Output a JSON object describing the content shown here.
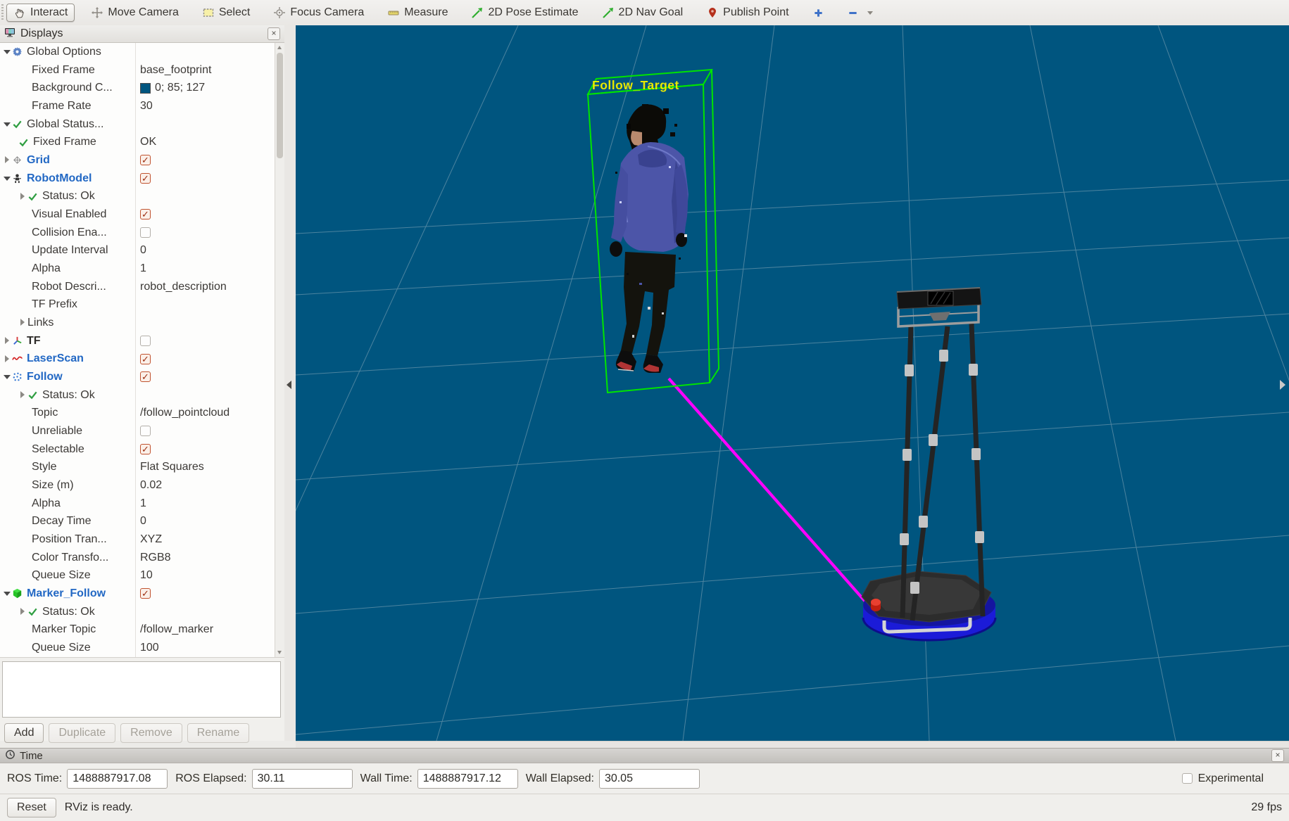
{
  "toolbar": {
    "tools": [
      {
        "label": "Interact",
        "icon": "hand-icon",
        "active": true
      },
      {
        "label": "Move Camera",
        "icon": "move-camera-icon"
      },
      {
        "label": "Select",
        "icon": "select-box-icon"
      },
      {
        "label": "Focus Camera",
        "icon": "focus-camera-icon"
      },
      {
        "label": "Measure",
        "icon": "measure-icon"
      },
      {
        "label": "2D Pose Estimate",
        "icon": "pose-arrow-icon"
      },
      {
        "label": "2D Nav Goal",
        "icon": "nav-arrow-icon"
      },
      {
        "label": "Publish Point",
        "icon": "publish-point-icon"
      },
      {
        "label": "",
        "icon": "add-tool-icon"
      },
      {
        "label": "",
        "icon": "remove-tool-icon",
        "caret": true
      }
    ]
  },
  "displays_panel": {
    "title": "Displays",
    "close_label": "×",
    "rows": [
      {
        "indent": 0,
        "expander": "open",
        "icon": "gear-icon",
        "label": "Global Options"
      },
      {
        "indent": 1,
        "label": "Fixed Frame",
        "value": "base_footprint"
      },
      {
        "indent": 1,
        "label": "Background C...",
        "swatch": "#00557F",
        "value": "0; 85; 127"
      },
      {
        "indent": 1,
        "label": "Frame Rate",
        "value": "30"
      },
      {
        "indent": 0,
        "expander": "open",
        "icon": "check-icon",
        "label": "Global Status..."
      },
      {
        "indent": 1,
        "icon": "check-icon",
        "label": "Fixed Frame",
        "value": "OK"
      },
      {
        "indent": 0,
        "expander": "closed",
        "icon": "grid-icon",
        "label": "Grid",
        "style": "display-on",
        "checkbox": true
      },
      {
        "indent": 0,
        "expander": "open",
        "icon": "robot-icon",
        "label": "RobotModel",
        "style": "display-on",
        "checkbox": true
      },
      {
        "indent": 1,
        "expander": "closed",
        "icon": "check-icon",
        "label": "Status: Ok"
      },
      {
        "indent": 1,
        "label": "Visual Enabled",
        "checkbox": true
      },
      {
        "indent": 1,
        "label": "Collision Ena...",
        "checkbox": false
      },
      {
        "indent": 1,
        "label": "Update Interval",
        "value": "0"
      },
      {
        "indent": 1,
        "label": "Alpha",
        "value": "1"
      },
      {
        "indent": 1,
        "label": "Robot Descri...",
        "value": "robot_description"
      },
      {
        "indent": 1,
        "label": "TF Prefix",
        "value": ""
      },
      {
        "indent": 1,
        "expander": "closed",
        "label": "Links"
      },
      {
        "indent": 0,
        "expander": "closed",
        "icon": "tf-icon",
        "label": "TF",
        "style": "display-off",
        "checkbox": false
      },
      {
        "indent": 0,
        "expander": "closed",
        "icon": "laser-icon",
        "label": "LaserScan",
        "style": "display-on",
        "checkbox": true
      },
      {
        "indent": 0,
        "expander": "open",
        "icon": "pointcloud-icon",
        "label": "Follow",
        "style": "display-on",
        "checkbox": true
      },
      {
        "indent": 1,
        "expander": "closed",
        "icon": "check-icon",
        "label": "Status: Ok"
      },
      {
        "indent": 1,
        "label": "Topic",
        "value": "/follow_pointcloud"
      },
      {
        "indent": 1,
        "label": "Unreliable",
        "checkbox": false
      },
      {
        "indent": 1,
        "label": "Selectable",
        "checkbox": true
      },
      {
        "indent": 1,
        "label": "Style",
        "value": "Flat Squares"
      },
      {
        "indent": 1,
        "label": "Size (m)",
        "value": "0.02"
      },
      {
        "indent": 1,
        "label": "Alpha",
        "value": "1"
      },
      {
        "indent": 1,
        "label": "Decay Time",
        "value": "0"
      },
      {
        "indent": 1,
        "label": "Position Tran...",
        "value": "XYZ"
      },
      {
        "indent": 1,
        "label": "Color Transfo...",
        "value": "RGB8"
      },
      {
        "indent": 1,
        "label": "Queue Size",
        "value": "10"
      },
      {
        "indent": 0,
        "expander": "open",
        "icon": "cube-icon",
        "label": "Marker_Follow",
        "style": "display-on",
        "checkbox": true
      },
      {
        "indent": 1,
        "expander": "closed",
        "icon": "check-icon",
        "label": "Status: Ok"
      },
      {
        "indent": 1,
        "label": "Marker Topic",
        "value": "/follow_marker"
      },
      {
        "indent": 1,
        "label": "Queue Size",
        "value": "100"
      }
    ],
    "buttons": [
      {
        "label": "Add",
        "enabled": true
      },
      {
        "label": "Duplicate",
        "enabled": false
      },
      {
        "label": "Remove",
        "enabled": false
      },
      {
        "label": "Rename",
        "enabled": false
      }
    ]
  },
  "viewport": {
    "background_color_rgb": "0; 85; 127",
    "background_hex": "#00557F",
    "follow_target_label": "Follow_Target",
    "label_color": "#e8e800",
    "bounding_box_color": "#00e400",
    "follow_line_color": "#ff00ff",
    "grid_line_color": "#a8bcc6"
  },
  "time_panel": {
    "title": "Time",
    "close_label": "×",
    "fields": [
      {
        "label": "ROS Time:",
        "value": "1488887917.08"
      },
      {
        "label": "ROS Elapsed:",
        "value": "30.11"
      },
      {
        "label": "Wall Time:",
        "value": "1488887917.12"
      },
      {
        "label": "Wall Elapsed:",
        "value": "30.05"
      }
    ],
    "experimental_label": "Experimental"
  },
  "status_bar": {
    "reset_label": "Reset",
    "message": "RViz is ready.",
    "fps": "29 fps"
  }
}
